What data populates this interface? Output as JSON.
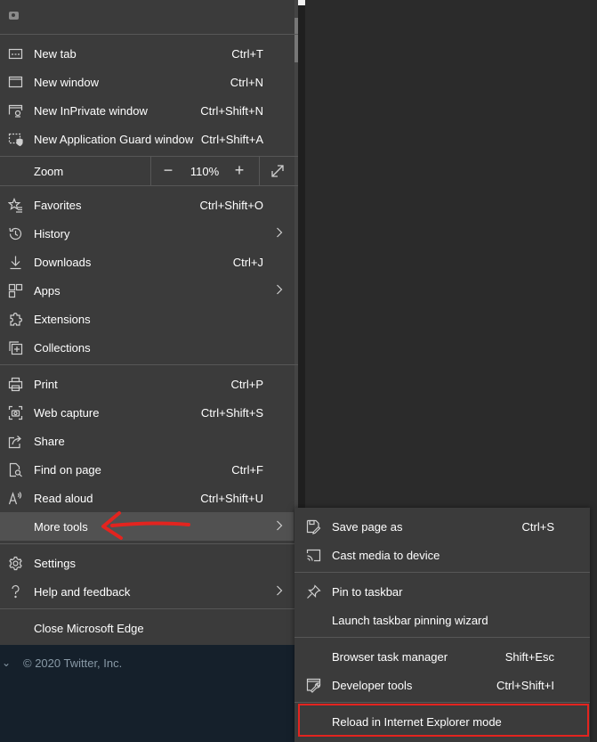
{
  "menu": {
    "group1": [
      {
        "label": "New tab",
        "shortcut": "Ctrl+T",
        "icon": "new-tab-icon"
      },
      {
        "label": "New window",
        "shortcut": "Ctrl+N",
        "icon": "new-window-icon"
      },
      {
        "label": "New InPrivate window",
        "shortcut": "Ctrl+Shift+N",
        "icon": "inprivate-icon"
      },
      {
        "label": "New Application Guard window",
        "shortcut": "Ctrl+Shift+A",
        "icon": "application-guard-icon"
      }
    ],
    "zoom": {
      "label": "Zoom",
      "minus": "−",
      "value": "110%",
      "plus": "+",
      "icon": "fullscreen-icon"
    },
    "group2": [
      {
        "label": "Favorites",
        "shortcut": "Ctrl+Shift+O",
        "icon": "favorites-icon"
      },
      {
        "label": "History",
        "shortcut": "",
        "icon": "history-icon",
        "submenu": true
      },
      {
        "label": "Downloads",
        "shortcut": "Ctrl+J",
        "icon": "downloads-icon"
      },
      {
        "label": "Apps",
        "shortcut": "",
        "icon": "apps-icon",
        "submenu": true
      },
      {
        "label": "Extensions",
        "shortcut": "",
        "icon": "extensions-icon"
      },
      {
        "label": "Collections",
        "shortcut": "",
        "icon": "collections-icon"
      }
    ],
    "group3": [
      {
        "label": "Print",
        "shortcut": "Ctrl+P",
        "icon": "print-icon"
      },
      {
        "label": "Web capture",
        "shortcut": "Ctrl+Shift+S",
        "icon": "web-capture-icon"
      },
      {
        "label": "Share",
        "shortcut": "",
        "icon": "share-icon"
      },
      {
        "label": "Find on page",
        "shortcut": "Ctrl+F",
        "icon": "find-icon"
      },
      {
        "label": "Read aloud",
        "shortcut": "Ctrl+Shift+U",
        "icon": "read-aloud-icon"
      },
      {
        "label": "More tools",
        "shortcut": "",
        "icon": "",
        "submenu": true
      }
    ],
    "group4": [
      {
        "label": "Settings",
        "shortcut": "",
        "icon": "settings-icon"
      },
      {
        "label": "Help and feedback",
        "shortcut": "",
        "icon": "help-icon",
        "submenu": true
      }
    ],
    "close": {
      "label": "Close Microsoft Edge"
    }
  },
  "submenu": {
    "items": [
      {
        "label": "Save page as",
        "shortcut": "Ctrl+S",
        "icon": "save-page-icon"
      },
      {
        "label": "Cast media to device",
        "shortcut": "",
        "icon": "cast-icon"
      },
      {
        "label": "Pin to taskbar",
        "shortcut": "",
        "icon": "pin-icon"
      },
      {
        "label": "Launch taskbar pinning wizard",
        "shortcut": "",
        "icon": ""
      },
      {
        "label": "Browser task manager",
        "shortcut": "Shift+Esc",
        "icon": ""
      },
      {
        "label": "Developer tools",
        "shortcut": "Ctrl+Shift+I",
        "icon": "developer-tools-icon"
      },
      {
        "label": "Reload in Internet Explorer mode",
        "shortcut": "",
        "icon": ""
      }
    ]
  },
  "background": {
    "footer_chevron": "⌄",
    "footer_text": "© 2020 Twitter, Inc."
  },
  "colors": {
    "menu_bg": "#3b3b3b",
    "highlight": "#515151",
    "annotation_red": "#e3241f"
  }
}
